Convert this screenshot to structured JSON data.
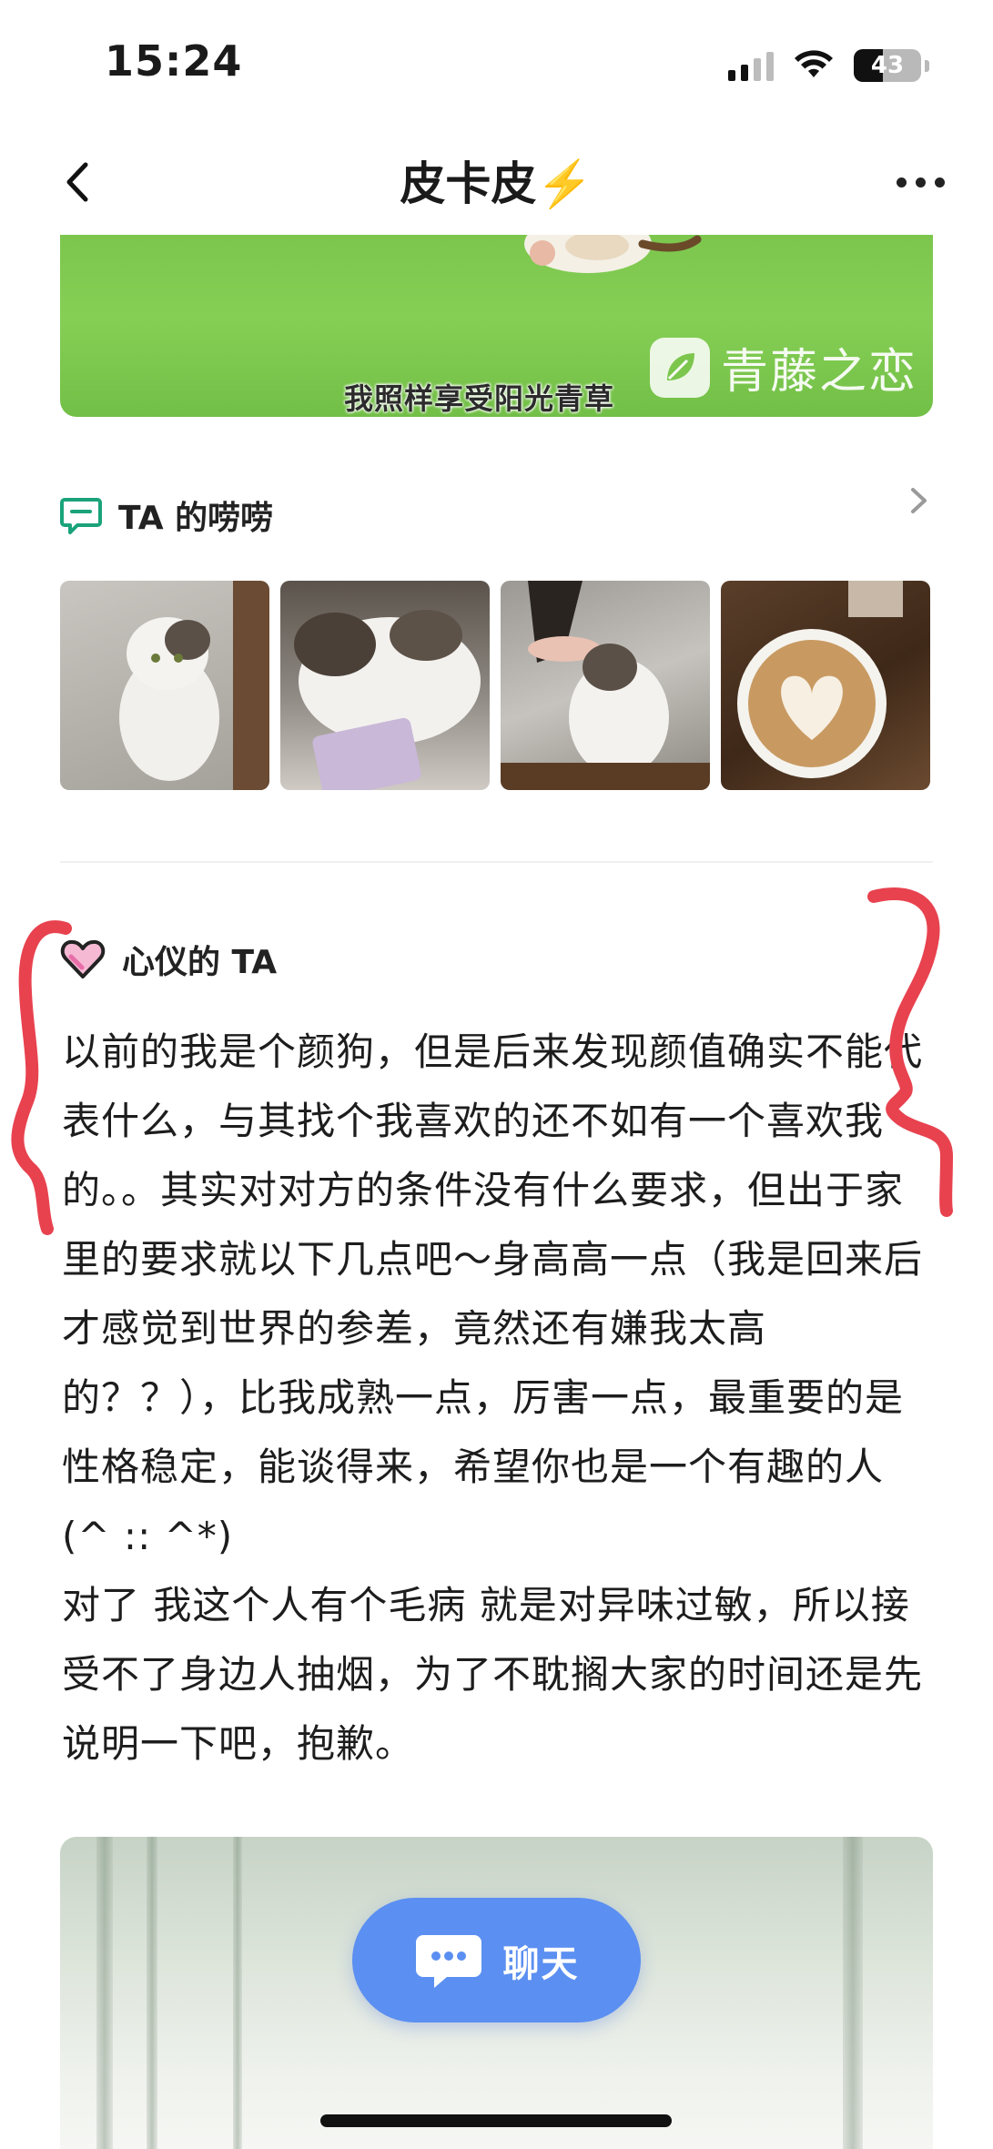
{
  "status_bar": {
    "time": "15:24",
    "battery": "43",
    "battery_level": 0.43,
    "icons": [
      "cellular-signal-icon",
      "wifi-icon",
      "battery-icon"
    ]
  },
  "nav": {
    "title": "皮卡皮⚡️",
    "back_icon": "chevron-left-icon",
    "more_icon": "more-dots-icon"
  },
  "banner": {
    "caption": "我照样享受阳光青草",
    "logo_text": "青藤之恋"
  },
  "posts_section": {
    "title": "TA 的唠唠",
    "icon": "message-bubble-icon",
    "arrow_icon": "chevron-right-icon",
    "photos": [
      "cat-photo-1",
      "cat-photo-2",
      "cat-photo-3",
      "latte-photo"
    ]
  },
  "ideal_section": {
    "title": "心仪的 TA",
    "icon": "heart-icon",
    "paragraphs": [
      "以前的我是个颜狗，但是后来发现颜值确实不能代表什么，与其找个我喜欢的还不如有一个喜欢我的。。其实对对方的条件没有什么要求，但出于家里的要求就以下几点吧～身高高一点（我是回来后才感觉到世界的参差，竟然还有嫌我太高的？？），比我成熟一点，厉害一点，最重要的是性格稳定，能谈得来，希望你也是一个有趣的人 (^ :: ^*)",
      "对了 我这个人有个毛病 就是对异味过敏，所以接受不了身边人抽烟，为了不耽搁大家的时间还是先说明一下吧，抱歉。"
    ]
  },
  "chat_button": {
    "label": "聊天",
    "icon": "chat-bubble-icon"
  },
  "colors": {
    "accent": "#5b8ff1",
    "banner_green": "#7cc64e",
    "annotation_red": "#e8424f",
    "section_icon_green": "#1aa37a"
  }
}
